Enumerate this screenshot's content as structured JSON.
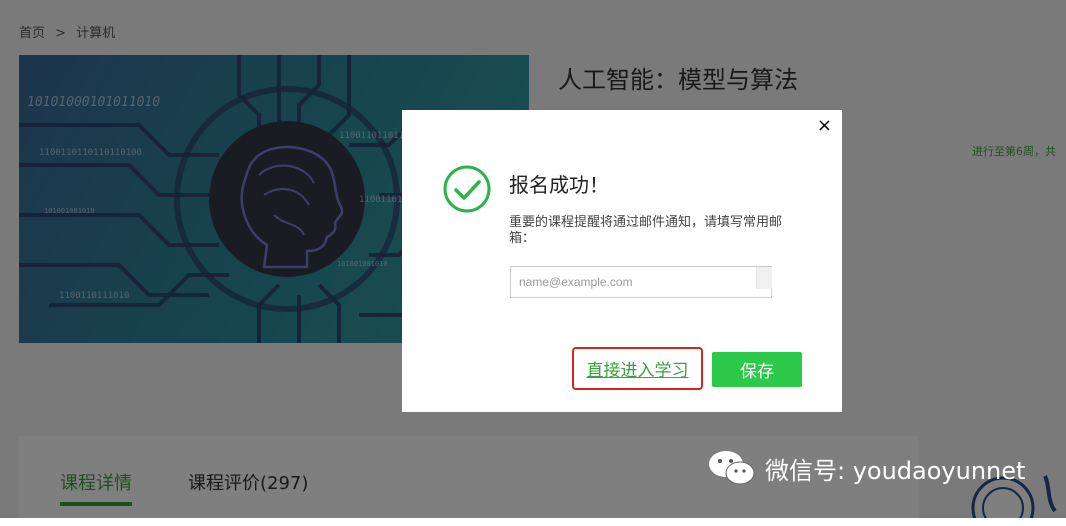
{
  "breadcrumb": {
    "home": "首页",
    "sep": ">",
    "category": "计算机"
  },
  "course": {
    "title": "人工智能：模型与算法",
    "progress_note": "进行至第6周，共"
  },
  "banner": {
    "binary": [
      "10101000101011010",
      "1100110110110110100",
      "1100110110110110100",
      "101001001010",
      "1100110110110110100",
      "101001001010",
      "1100110111010"
    ]
  },
  "tabs": [
    {
      "label": "课程详情"
    },
    {
      "label": "课程评价(297)"
    }
  ],
  "modal": {
    "title": "报名成功！",
    "message": "重要的课程提醒将通过邮件通知，请填写常用邮箱：",
    "email_placeholder": "name@example.com",
    "direct_link": "直接进入学习",
    "save_label": "保存",
    "close_symbol": "×"
  },
  "watermark": {
    "text": "微信号: youdaoyunnet"
  },
  "colors": {
    "accent": "#39a33c",
    "save": "#2cc94a",
    "highlight": "#d9241c"
  }
}
